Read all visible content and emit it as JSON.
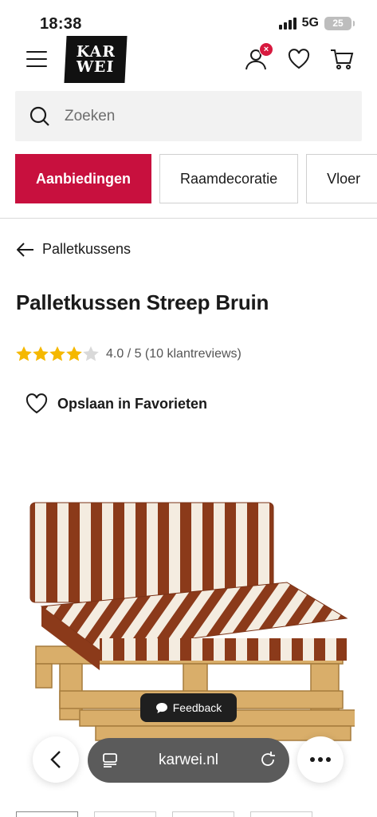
{
  "status_bar": {
    "time": "18:38",
    "network": "5G",
    "battery": "25"
  },
  "header": {
    "logo_line1": "KAR",
    "logo_line2": "WEI",
    "account_badge": "×"
  },
  "search": {
    "placeholder": "Zoeken",
    "value": ""
  },
  "categories": [
    {
      "label": "Aanbiedingen",
      "active": true
    },
    {
      "label": "Raamdecoratie",
      "active": false
    },
    {
      "label": "Vloer",
      "active": false
    }
  ],
  "breadcrumb": {
    "back_label": "Palletkussens"
  },
  "product": {
    "title": "Palletkussen Streep Bruin",
    "rating_value": 4.0,
    "rating_max": 5,
    "rating_text": "4.0 / 5 (10 klantreviews)",
    "favorite_label": "Opslaan in Favorieten"
  },
  "feedback": {
    "label": "Feedback"
  },
  "browser": {
    "url": "karwei.nl"
  },
  "colors": {
    "accent": "#c8103e",
    "star": "#f5b800",
    "star_empty": "#d9d9d9",
    "stripe": "#8b3a1a"
  }
}
